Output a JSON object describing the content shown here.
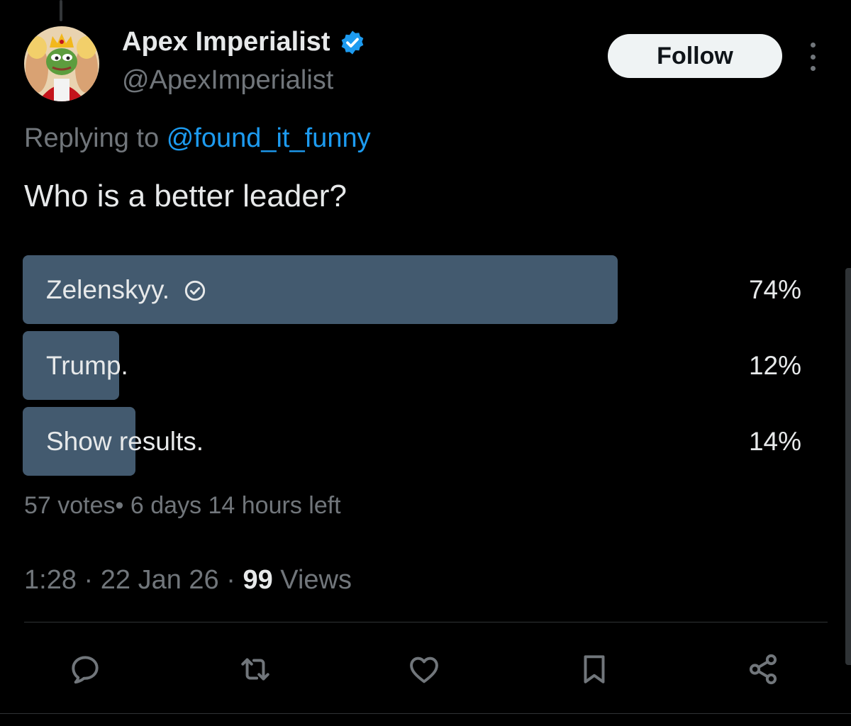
{
  "author": {
    "display_name": "Apex Imperialist",
    "handle": "@ApexImperialist",
    "verified": true
  },
  "follow_label": "Follow",
  "reply_context": {
    "prefix": "Replying to",
    "handle": "@found_it_funny"
  },
  "tweet_text": "Who is a better leader?",
  "poll": {
    "options": [
      {
        "label": "Zelenskyy.",
        "percent_text": "74%",
        "percent": 74,
        "selected": true
      },
      {
        "label": "Trump.",
        "percent_text": "12%",
        "percent": 12,
        "selected": false
      },
      {
        "label": "Show results.",
        "percent_text": "14%",
        "percent": 14,
        "selected": false
      }
    ],
    "votes": "57 votes",
    "separator": "• ",
    "time_left": "6 days 14 hours left"
  },
  "meta": {
    "time": "1:28",
    "date": "22 Jan 26",
    "views_count": "99",
    "views_label": "Views"
  },
  "actions": [
    "reply-icon",
    "repost-icon",
    "like-icon",
    "bookmark-icon",
    "share-icon"
  ],
  "colors": {
    "background": "#000000",
    "poll_fill": "#435a6f",
    "link": "#1d9bf0",
    "muted_text": "#71767b",
    "verified": "#1d9bf0"
  }
}
